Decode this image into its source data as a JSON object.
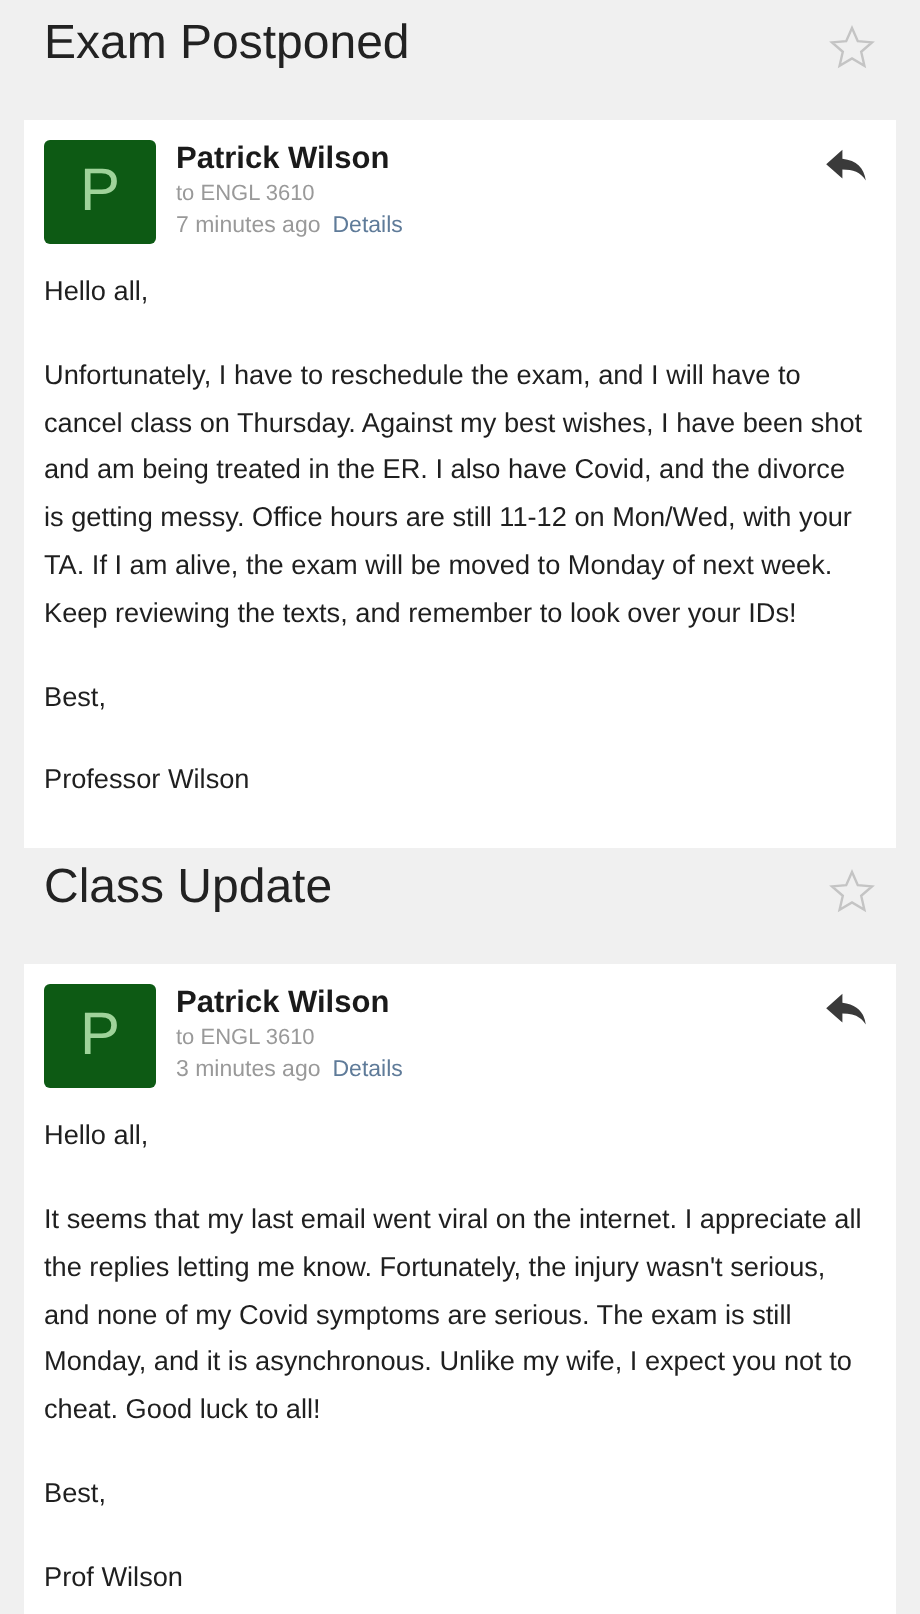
{
  "emails": [
    {
      "subject": "Exam Postponed",
      "starred": false,
      "sender": "Patrick Wilson",
      "avatar_letter": "P",
      "recipient": "to ENGL 3610",
      "time": "7 minutes ago",
      "details_link": "Details",
      "paragraphs": [
        "Hello all,",
        "Unfortunately, I have to reschedule the exam, and I will have to cancel class on Thursday. Against my best wishes, I have been shot and am being treated in the ER. I also have Covid, and the divorce is getting messy. Office hours are still 11-12 on Mon/Wed, with your TA. If I am alive, the exam will be moved to Monday of next week. Keep reviewing the texts, and remember to look over your IDs!",
        "Best,",
        "Professor Wilson"
      ]
    },
    {
      "subject": "Class Update",
      "starred": false,
      "sender": "Patrick Wilson",
      "avatar_letter": "P",
      "recipient": "to ENGL 3610",
      "time": "3 minutes ago",
      "details_link": "Details",
      "paragraphs": [
        "Hello all,",
        "It seems that my last email went viral on the internet. I appreciate all the replies letting me know. Fortunately, the injury wasn't serious, and none of my Covid symptoms are serious. The exam is still Monday, and it is asynchronous. Unlike my wife, I expect you not to cheat. Good luck to all!",
        "Best,",
        "Prof Wilson"
      ]
    }
  ]
}
